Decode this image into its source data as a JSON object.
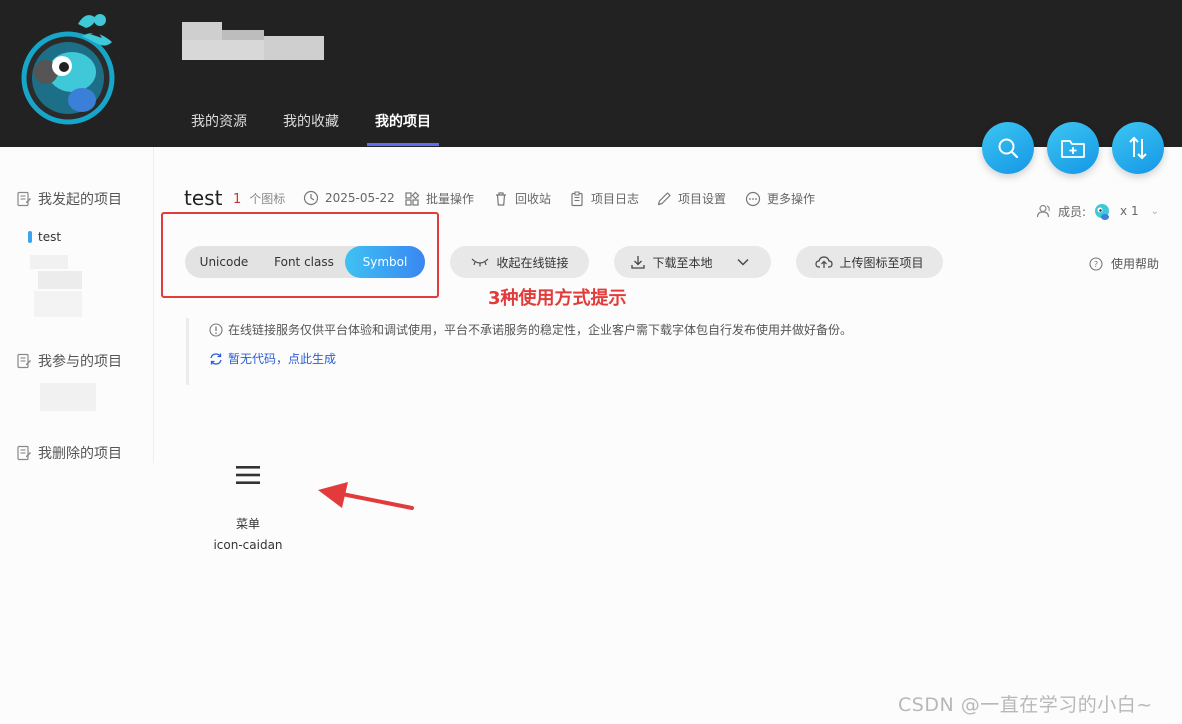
{
  "header": {
    "nav": [
      {
        "label": "我的资源",
        "active": false
      },
      {
        "label": "我的收藏",
        "active": false
      },
      {
        "label": "我的项目",
        "active": true
      }
    ],
    "fab": [
      {
        "icon": "search-icon"
      },
      {
        "icon": "folder-add-icon"
      },
      {
        "icon": "sort-icon"
      }
    ]
  },
  "sidebar": {
    "groups": [
      {
        "label": "我发起的项目"
      },
      {
        "label": "我参与的项目"
      },
      {
        "label": "我删除的项目"
      }
    ],
    "selected_project": "test"
  },
  "project": {
    "title": "test",
    "icon_count": "1",
    "icon_count_unit": "个图标",
    "date": "2025-05-22",
    "tools": {
      "batch": "批量操作",
      "recycle": "回收站",
      "log": "项目日志",
      "settings": "项目设置",
      "more": "更多操作"
    },
    "members_label": "成员:",
    "members_count": "x 1"
  },
  "usage_tabs": [
    {
      "label": "Unicode",
      "active": false
    },
    {
      "label": "Font class",
      "active": false
    },
    {
      "label": "Symbol",
      "active": true
    }
  ],
  "buttons": {
    "collapse_link": "收起在线链接",
    "download": "下载至本地",
    "upload": "上传图标至项目",
    "help": "使用帮助"
  },
  "annotation": "3种使用方式提示",
  "notice": {
    "text": "在线链接服务仅供平台体验和调试使用，平台不承诺服务的稳定性，企业客户需下载字体包自行发布使用并做好备份。",
    "generate": "暂无代码，点此生成"
  },
  "icons": [
    {
      "name": "菜单",
      "code": "icon-caidan"
    }
  ],
  "watermark": "CSDN @一直在学习的小白~",
  "colors": {
    "accent": "#3a86f2",
    "annotation": "#e23b3b",
    "count": "#d03030"
  }
}
